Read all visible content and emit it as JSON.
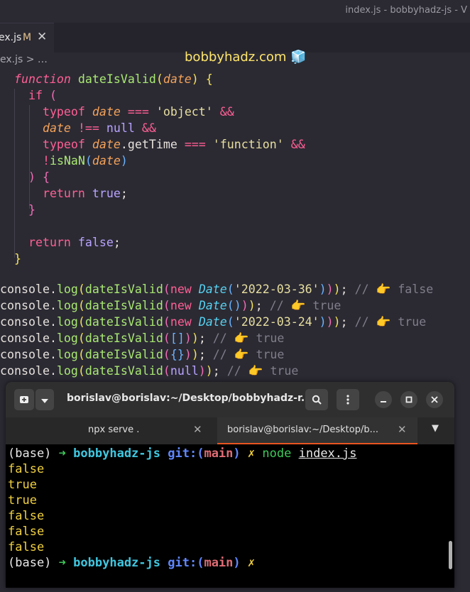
{
  "window": {
    "title": "index.js - bobbyhadz-js - V"
  },
  "tab": {
    "label": "ex.js",
    "modified": "M",
    "close": "✕"
  },
  "watermark": "bobbyhadz.com 🧊",
  "breadcrumb": "ex.js > …",
  "code": {
    "l1": {
      "kw": "function",
      "name": "dateIsValid",
      "param": "date"
    },
    "l2": {
      "kw": "if"
    },
    "l3": {
      "kw": "typeof",
      "param": "date",
      "op": "===",
      "str": "'object'",
      "and": "&&"
    },
    "l4": {
      "param": "date",
      "op": "!==",
      "val": "null",
      "and": "&&"
    },
    "l5": {
      "kw": "typeof",
      "param": "date",
      "member": "getTime",
      "op": "===",
      "str": "'function'",
      "and": "&&"
    },
    "l6": {
      "not": "!",
      "fn": "isNaN",
      "param": "date"
    },
    "l8": {
      "kw": "return",
      "val": "true"
    },
    "l11": {
      "kw": "return",
      "val": "false"
    },
    "logs": [
      {
        "obj": "console",
        "fn": "log",
        "call": "dateIsValid",
        "kw": "new",
        "cls": "Date",
        "arg": "'2022-03-36'",
        "result": "false"
      },
      {
        "obj": "console",
        "fn": "log",
        "call": "dateIsValid",
        "kw": "new",
        "cls": "Date",
        "arg": "",
        "result": "true"
      },
      {
        "obj": "console",
        "fn": "log",
        "call": "dateIsValid",
        "kw": "new",
        "cls": "Date",
        "arg": "'2022-03-24'",
        "result": "true"
      },
      {
        "obj": "console",
        "fn": "log",
        "call": "dateIsValid",
        "arg": "[]",
        "result": "true"
      },
      {
        "obj": "console",
        "fn": "log",
        "call": "dateIsValid",
        "arg": "{}",
        "result": "true"
      },
      {
        "obj": "console",
        "fn": "log",
        "call": "dateIsValid",
        "arg": "null",
        "result": "true"
      }
    ],
    "comment_prefix": "//",
    "pointer": "👉"
  },
  "terminal": {
    "title": "borislav@borislav:~/Desktop/bobbyhadz-r...",
    "tabs": [
      {
        "label": "npx serve ."
      },
      {
        "label": "borislav@borislav:~/Desktop/b..."
      }
    ],
    "prompt": {
      "env": "(base)",
      "arrow": "➜",
      "dir": "bobbyhadz-js",
      "git": "git:",
      "branch_open": "(",
      "branch": "main",
      "branch_close": ")",
      "dirty": "✗"
    },
    "command": {
      "cmd": "node",
      "arg": "index.js"
    },
    "output": [
      "false",
      "true",
      "true",
      "false",
      "false",
      "false"
    ]
  }
}
